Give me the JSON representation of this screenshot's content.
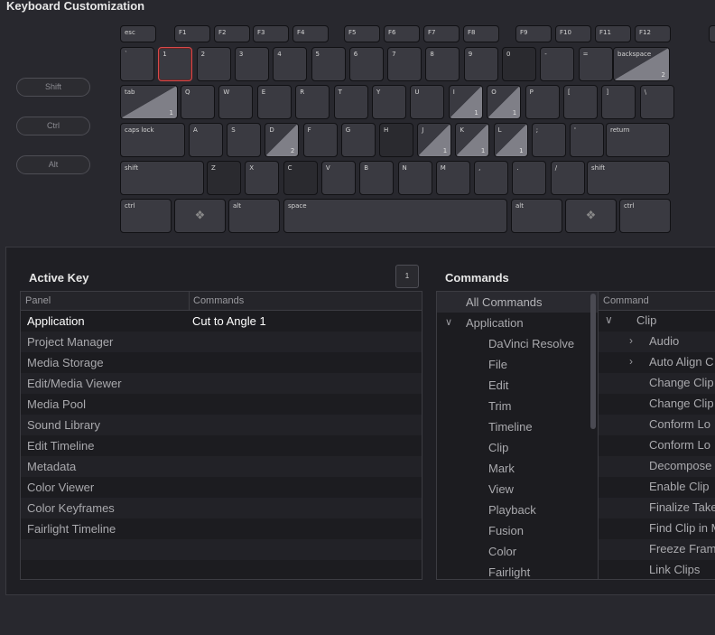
{
  "window": {
    "title": "Keyboard Customization"
  },
  "keyboard": {
    "function_row": [
      "esc",
      "F1",
      "F2",
      "F3",
      "F4",
      "F5",
      "F6",
      "F7",
      "F8",
      "F9",
      "F10",
      "F11",
      "F12"
    ],
    "number_row": [
      "`",
      "1",
      "2",
      "3",
      "4",
      "5",
      "6",
      "7",
      "8",
      "9",
      "0",
      "-",
      "=",
      "backspace"
    ],
    "qwerty_row": [
      "tab",
      "Q",
      "W",
      "E",
      "R",
      "T",
      "Y",
      "U",
      "I",
      "O",
      "P",
      "[",
      "]",
      "\\"
    ],
    "home_row": [
      "caps lock",
      "A",
      "S",
      "D",
      "F",
      "G",
      "H",
      "J",
      "K",
      "L",
      ";",
      "'",
      "return"
    ],
    "shift_row": [
      "shift",
      "Z",
      "X",
      "C",
      "V",
      "B",
      "N",
      "M",
      ",",
      ".",
      "/",
      "shift"
    ],
    "bottom_row": [
      "ctrl",
      "",
      "alt",
      "space",
      "alt",
      "",
      "ctrl"
    ],
    "assigned_counts": {
      "backspace": "2",
      "tab": "1",
      "I": "1",
      "O": "1",
      "D": "2",
      "J": "1",
      "K": "1",
      "L": "1"
    },
    "selected_key": "1",
    "modifiers": [
      "Shift",
      "Ctrl",
      "Alt"
    ]
  },
  "active_key": {
    "title": "Active Key",
    "count": "1",
    "columns": [
      "Panel",
      "Commands"
    ],
    "rows": [
      {
        "panel": "Application",
        "command": "Cut to Angle 1"
      },
      {
        "panel": "Project Manager",
        "command": ""
      },
      {
        "panel": "Media Storage",
        "command": ""
      },
      {
        "panel": "Edit/Media Viewer",
        "command": ""
      },
      {
        "panel": "Media Pool",
        "command": ""
      },
      {
        "panel": "Sound Library",
        "command": ""
      },
      {
        "panel": "Edit Timeline",
        "command": ""
      },
      {
        "panel": "Metadata",
        "command": ""
      },
      {
        "panel": "Color Viewer",
        "command": ""
      },
      {
        "panel": "Color Keyframes",
        "command": ""
      },
      {
        "panel": "Fairlight Timeline",
        "command": ""
      },
      {
        "panel": "",
        "command": ""
      },
      {
        "panel": "",
        "command": ""
      }
    ]
  },
  "commands": {
    "title": "Commands",
    "all_label": "All Commands",
    "group_label": "Application",
    "categories": [
      "DaVinci Resolve",
      "File",
      "Edit",
      "Trim",
      "Timeline",
      "Clip",
      "Mark",
      "View",
      "Playback",
      "Fusion",
      "Color",
      "Fairlight"
    ],
    "list_header": "Command",
    "list": [
      {
        "label": "Clip",
        "level": 0,
        "chevron": "∨"
      },
      {
        "label": "Audio",
        "level": 1,
        "chevron": "›"
      },
      {
        "label": "Auto Align C",
        "level": 1,
        "chevron": "›"
      },
      {
        "label": "Change Clip",
        "level": 2,
        "chevron": ""
      },
      {
        "label": "Change Clip",
        "level": 2,
        "chevron": ""
      },
      {
        "label": "Conform Lo",
        "level": 2,
        "chevron": ""
      },
      {
        "label": "Conform Lo",
        "level": 2,
        "chevron": ""
      },
      {
        "label": "Decompose",
        "level": 2,
        "chevron": ""
      },
      {
        "label": "Enable Clip",
        "level": 2,
        "chevron": ""
      },
      {
        "label": "Finalize Take",
        "level": 2,
        "chevron": ""
      },
      {
        "label": "Find Clip in M",
        "level": 2,
        "chevron": ""
      },
      {
        "label": "Freeze Fram",
        "level": 2,
        "chevron": ""
      },
      {
        "label": "Link Clips",
        "level": 2,
        "chevron": ""
      }
    ]
  }
}
